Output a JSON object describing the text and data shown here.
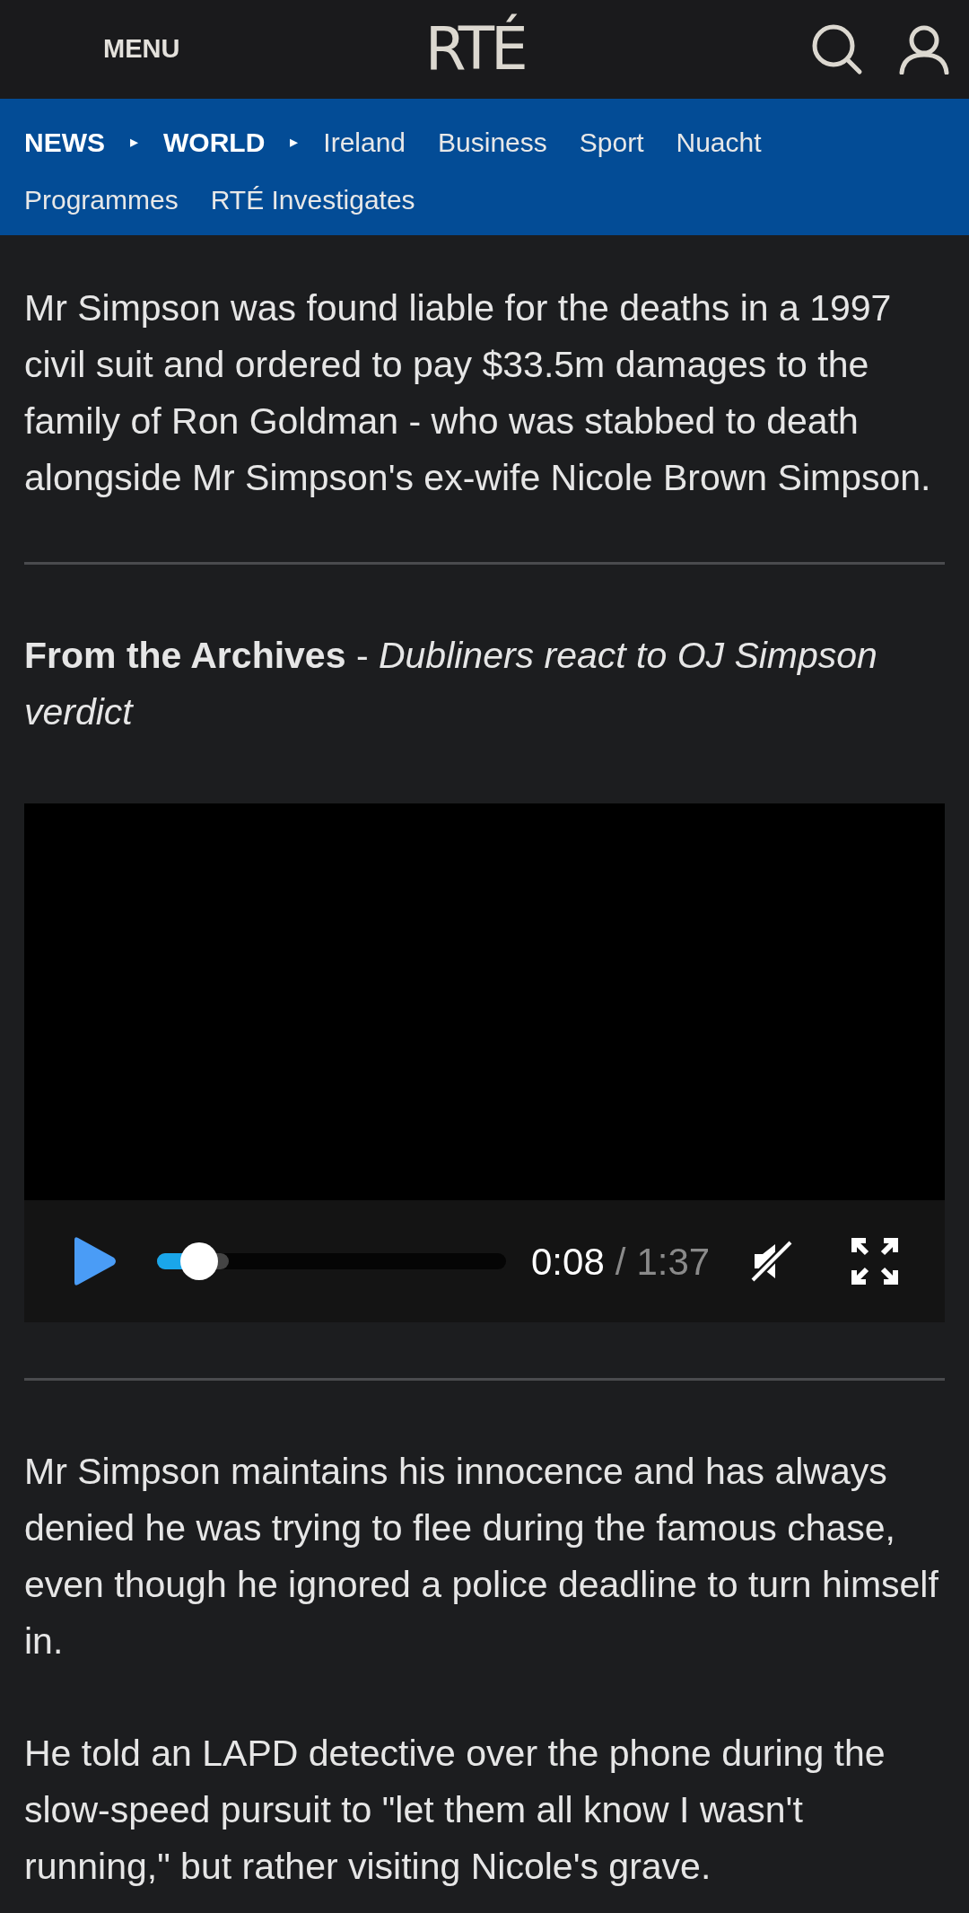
{
  "header": {
    "menu_label": "MENU",
    "logo": "RTÉ"
  },
  "nav": {
    "items": [
      {
        "kind": "crumb",
        "text": "NEWS"
      },
      {
        "kind": "separator",
        "text": "▸"
      },
      {
        "kind": "crumb",
        "text": "WORLD"
      },
      {
        "kind": "separator",
        "text": "▸"
      },
      {
        "kind": "link",
        "text": "Ireland"
      },
      {
        "kind": "link",
        "text": "Business"
      },
      {
        "kind": "link",
        "text": "Sport"
      },
      {
        "kind": "link",
        "text": "Nuacht"
      },
      {
        "kind": "link",
        "text": "Programmes"
      },
      {
        "kind": "link",
        "text": "RTÉ Investigates"
      }
    ]
  },
  "article": [
    {
      "kind": "paragraph",
      "text": "Mr Simpson was found liable for the deaths in a 1997 civil suit and ordered to pay $33.5m damages to the family of Ron Goldman - who was stabbed to death alongside Mr Simpson's ex-wife Nicole Brown Simpson."
    },
    {
      "kind": "divider"
    },
    {
      "kind": "heading",
      "text": "**From the Archives** - *Dubliners react to OJ Simpson verdict*"
    },
    {
      "kind": "video",
      "current_time": "0:08",
      "separator": "/",
      "duration": "1:37",
      "level": 0.12,
      "muted": true
    },
    {
      "kind": "divider"
    },
    {
      "kind": "paragraph",
      "text": "Mr Simpson maintains his innocence and has always denied he was trying to flee during the famous chase, even though he ignored a police deadline to turn himself in."
    },
    {
      "kind": "paragraph",
      "text": "He told an LAPD detective over the phone during the slow-speed pursuit to \"let them all know I wasn't running,\" but rather visiting Nicole's grave."
    }
  ]
}
